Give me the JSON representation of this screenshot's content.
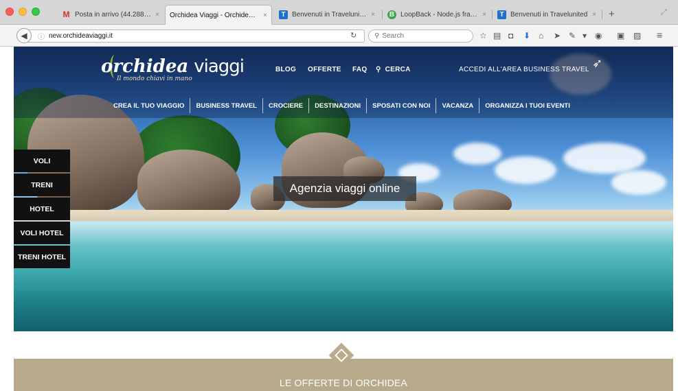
{
  "browser": {
    "tabs": [
      {
        "icon": "gmail-icon",
        "favicon": "M",
        "title": "Posta in arrivo (44.288) - ...",
        "close": "×",
        "active": false
      },
      {
        "icon": "",
        "favicon": "",
        "title": "Orchidea Viaggi - Orchidea Vi...",
        "close": "×",
        "active": true
      },
      {
        "icon": "travelunited-icon",
        "favicon": "T",
        "title": "Benvenuti in Travelunited",
        "close": "×",
        "active": false
      },
      {
        "icon": "loopback-icon",
        "favicon": "B",
        "title": "LoopBack - Node.js frame...",
        "close": "×",
        "active": false
      },
      {
        "icon": "travelunited-icon",
        "favicon": "T",
        "title": "Benvenuti in Travelunited",
        "close": "×",
        "active": false
      }
    ],
    "new_tab": "+",
    "url_prefix": "new.",
    "url_host": "orchideaviaggi.it",
    "search_placeholder": "Search"
  },
  "site": {
    "logo_main": "orchidea",
    "logo_second": "viaggi",
    "logo_tagline": "Il mondo chiavi in mano",
    "top_nav": {
      "blog": "BLOG",
      "offerte": "OFFERTE",
      "faq": "FAQ",
      "cerca": "CERCA",
      "business_area": "ACCEDI ALL'AREA BUSINESS TRAVEL"
    },
    "main_nav": [
      "CREA IL TUO VIAGGIO",
      "BUSINESS TRAVEL",
      "CROCIERE",
      "DESTINAZIONI",
      "SPOSATI CON NOI",
      "VACANZA",
      "ORGANIZZA I TUOI EVENTI"
    ],
    "side_menu": [
      "VOLI",
      "TRENI",
      "HOTEL",
      "VOLI HOTEL",
      "TRENI HOTEL"
    ],
    "hero_title": "Agenzia viaggi online",
    "offers_title": "LE OFFERTE DI ORCHIDEA"
  },
  "colors": {
    "side_menu_bg": "#111111",
    "offers_band": "#b7aa8a",
    "logo_accent": "#8ab833"
  }
}
